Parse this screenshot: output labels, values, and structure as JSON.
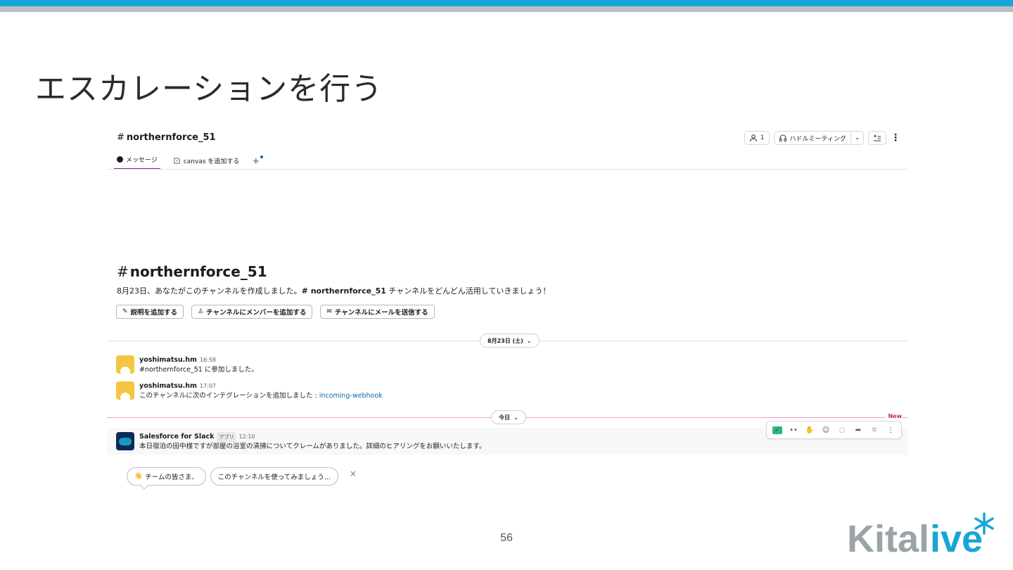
{
  "slide": {
    "title": "エスカレーションを行う",
    "page_number": "56",
    "logo_text": "Kitalive"
  },
  "colors": {
    "top_bar": "#16a6d6",
    "gray_bar": "#b9bfc4",
    "tab_active": "#7c3085",
    "new_line": "#e7a6c8",
    "new_label": "#c7275e",
    "link": "#1264a3",
    "logo_gray": "#9aa3a8",
    "logo_blue": "#16a6d6"
  },
  "channel": {
    "hash": "#",
    "name": "northernforce_51",
    "member_count": "1",
    "huddle_label": "ハドルミーティング"
  },
  "tabs": [
    {
      "label": "メッセージ",
      "icon": "message-dot-icon",
      "active": true
    },
    {
      "label": "canvas を追加する",
      "icon": "canvas-icon",
      "active": false
    }
  ],
  "tab_add_label": "+",
  "intro": {
    "hash": "#",
    "title": "northernforce_51",
    "text_before": "8月23日、あなたがこのチャンネルを作成しました。",
    "text_channel": "# northernforce_51",
    "text_after": " チャンネルをどんどん活用していきましょう！",
    "buttons": [
      {
        "icon": "✎",
        "label": "説明を追加する"
      },
      {
        "icon": "♙",
        "label": "チャンネルにメンバーを追加する"
      },
      {
        "icon": "✉",
        "label": "チャンネルにメールを送信する"
      }
    ]
  },
  "date_divider_1": {
    "label": "8月23日 (土)",
    "chevron": "⌄"
  },
  "date_divider_2": {
    "label": "今日",
    "chevron": "⌄"
  },
  "new_label": "New",
  "messages": [
    {
      "name": "yoshimatsu.hm",
      "time": "16:58",
      "text": "#northernforce_51 に参加しました。"
    },
    {
      "name": "yoshimatsu.hm",
      "time": "17:07",
      "text": "このチャンネルに次のインテグレーションを追加しました : ",
      "link": "incoming-webhook"
    }
  ],
  "highlight_message": {
    "name": "Salesforce for Slack",
    "badge": "アプリ",
    "time": "12:10",
    "text": "本日宿泊の田中様ですが部屋の浴室の清掃についてクレームがありました。詳細のヒアリングをお願いいたします。"
  },
  "hover_actions": [
    "check-reaction-icon",
    "eyes-reaction-icon",
    "clap-reaction-icon",
    "add-reaction-icon",
    "reply-thread-icon",
    "share-icon",
    "bookmark-icon",
    "more-actions-icon"
  ],
  "suggestions": [
    {
      "icon": "👋",
      "label": "チームの皆さま、"
    },
    {
      "icon": "",
      "label": "このチャンネルを使ってみましょう..."
    }
  ],
  "suggestion_close": "×"
}
